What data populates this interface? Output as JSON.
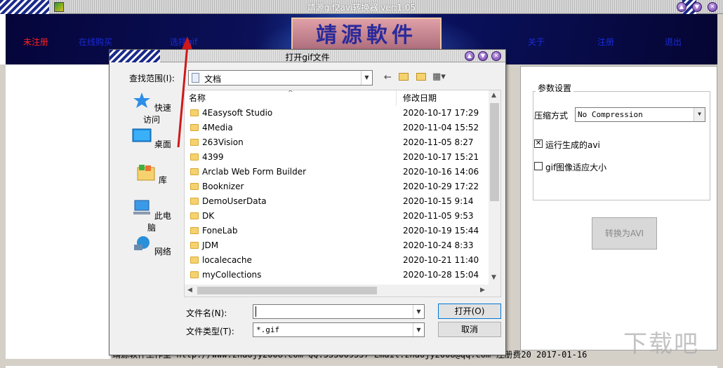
{
  "window": {
    "title": "靖源gif2avi转换器 ver:1.05"
  },
  "menu": {
    "unregistered": "未注册",
    "buy_online": "在线购买",
    "select_gif": "选择gif",
    "about": "关于",
    "register": "注册",
    "exit": "退出"
  },
  "banner": {
    "logo_text": "靖源軟件"
  },
  "footer_text": "靖源软件工作室 http://www.zhaojy2008.com QQ:355069557 Email:zhaojy2008@qq.com 注册费20 2017-01-16",
  "settings": {
    "group_title": "参数设置",
    "compression_label": "压缩方式",
    "compression_value": "No Compression",
    "run_avi_label": "运行生成的avi",
    "run_avi_checked": true,
    "fit_label": "gif图像适应大小",
    "fit_checked": false,
    "convert_label": "转换为AVI"
  },
  "dialog": {
    "title": "打开gif文件",
    "lookin_label": "查找范围(I):",
    "lookin_value": "文档",
    "places": [
      {
        "label": "快速访问",
        "icon": "star-icon"
      },
      {
        "label": "桌面",
        "icon": "desktop-icon"
      },
      {
        "label": "库",
        "icon": "library-icon"
      },
      {
        "label": "此电脑",
        "icon": "computer-icon"
      },
      {
        "label": "网络",
        "icon": "network-icon"
      }
    ],
    "columns": {
      "name": "名称",
      "date": "修改日期"
    },
    "files": [
      {
        "name": "4Easysoft Studio",
        "date": "2020-10-17 17:29"
      },
      {
        "name": "4Media",
        "date": "2020-11-04 15:52"
      },
      {
        "name": "263Vision",
        "date": "2020-11-05 8:27"
      },
      {
        "name": "4399",
        "date": "2020-10-17 15:21"
      },
      {
        "name": "Arclab Web Form Builder",
        "date": "2020-10-16 14:06"
      },
      {
        "name": "Booknizer",
        "date": "2020-10-29 17:22"
      },
      {
        "name": "DemoUserData",
        "date": "2020-10-15 9:14"
      },
      {
        "name": "DK",
        "date": "2020-11-05 9:53"
      },
      {
        "name": "FoneLab",
        "date": "2020-10-19 15:44"
      },
      {
        "name": "JDM",
        "date": "2020-10-24 8:33"
      },
      {
        "name": "localecache",
        "date": "2020-10-21 11:40"
      },
      {
        "name": "myCollections",
        "date": "2020-10-28 15:04"
      }
    ],
    "filename_label": "文件名(N):",
    "filename_value": "",
    "filetype_label": "文件类型(T):",
    "filetype_value": "*.gif",
    "open_label": "打开(O)",
    "cancel_label": "取消"
  },
  "watermark": "下载吧"
}
